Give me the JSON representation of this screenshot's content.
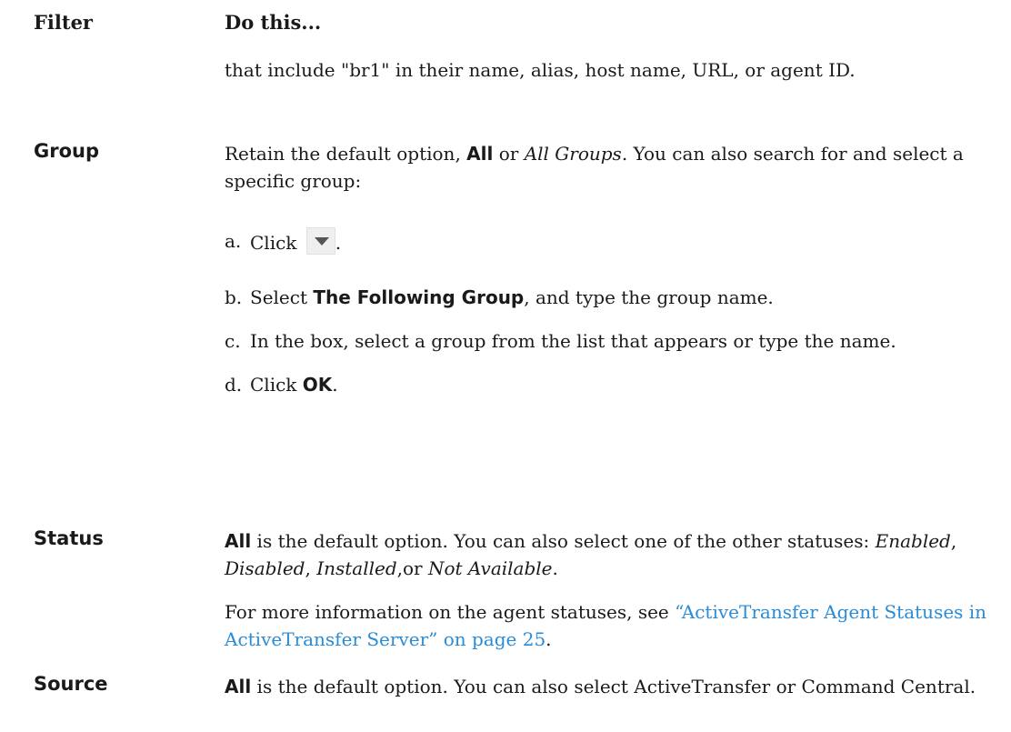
{
  "header": {
    "filter_col": "Filter",
    "do_col": "Do this..."
  },
  "continuation": {
    "text": "that include \"br1\" in their name, alias, host name, URL, or agent ID."
  },
  "group": {
    "term": "Group",
    "desc_pre": "Retain the default option, ",
    "desc_bold": "All",
    "desc_mid": " or ",
    "desc_italic": "All Groups",
    "desc_post": ". You can also search for and select a specific group:",
    "steps": {
      "a_mark": "a.",
      "a_text": "Click ",
      "a_icon": "dropdown-arrow-icon",
      "a_end": ".",
      "b_mark": "b.",
      "b_pre": "Select ",
      "b_bold": "The Following Group",
      "b_post": ", and type the group name.",
      "c_mark": "c.",
      "c_text": "In the box, select a group from the list that appears or type the name.",
      "d_mark": "d.",
      "d_pre": "Click ",
      "d_bold": "OK",
      "d_post": "."
    }
  },
  "status": {
    "term": "Status",
    "bold": "All",
    "text1": " is the default option. You can also select one of the other statuses: ",
    "s1": "Enabled",
    "sep1": ", ",
    "s2": "Disabled",
    "sep2": ", ",
    "s3": "Installed",
    "sep3": ",or ",
    "s4": "Not Available",
    "end": ".",
    "more_pre": "For more information on the agent statuses, see ",
    "more_link": "“ActiveTransfer Agent Statuses in ActiveTransfer Server” on page 25",
    "more_post": "."
  },
  "source": {
    "term": "Source",
    "bold": "All",
    "text": " is the default option. You can also select ActiveTransfer or Command Central."
  },
  "colors": {
    "link": "#2a8bd6",
    "text": "#1a1a1a"
  }
}
